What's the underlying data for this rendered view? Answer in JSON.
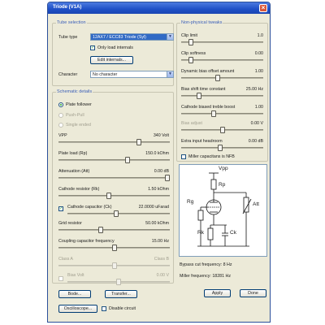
{
  "window": {
    "title": "Triode (V1A)"
  },
  "tube_selection": {
    "title": "Tube selection",
    "tube_type_label": "Tube type",
    "tube_type_value": "12AX7 / ECC83 Triode (Syl)",
    "only_load_internals_label": "Only load internals",
    "only_load_internals_checked": true,
    "edit_internals_button": "Edit internals...",
    "character_label": "Character",
    "character_value": "No character"
  },
  "schematic_details": {
    "title": "Schematic details",
    "plate_follower": "Plate follower",
    "push_pull": "Push-Pull",
    "single_ended": "Single ended",
    "selected_mode": "Plate follower",
    "vpp": {
      "label": "VPP",
      "value": "340 Volt",
      "level": 0.72
    },
    "plate_load": {
      "label": "Plate load (Rp)",
      "value": "150.0 kOhm",
      "level": 0.62
    },
    "attenuation": {
      "label": "Attenuation (Att)",
      "value": "0.00 dB",
      "level": 0.98
    },
    "cathode_resistor": {
      "label": "Cathode resistor (Rk)",
      "value": "1.50 kOhm",
      "level": 0.45
    },
    "cathode_capacitor": {
      "label": "Cathode capacitor (Ck)",
      "value": "22.0000 uFarad",
      "checked": true,
      "level": 0.48
    },
    "grid_resistor": {
      "label": "Grid resistor",
      "value": "50.00 kOhm",
      "level": 0.38
    },
    "coupling_capacitor": {
      "label": "Coupling capacitor frequency",
      "value": "15.00 Hz",
      "level": 0.5
    },
    "class_a": "Class A",
    "class_b": "Class B",
    "class_level": 0.5,
    "bias_volt": {
      "label": "Bias Volt",
      "value": "0.00 V",
      "level": 0.5
    }
  },
  "non_physical": {
    "title": "Non-physical tweaks",
    "clip_limit": {
      "label": "Clip limit",
      "value": "1.0",
      "level": 0.12
    },
    "clip_softness": {
      "label": "Clip softness",
      "value": "0.00",
      "level": 0.12
    },
    "dynamic_bias": {
      "label": "Dynamic bias offset amount",
      "value": "1.00",
      "level": 0.45
    },
    "bias_shift": {
      "label": "Bias shift time constant",
      "value": "25.00 Hz",
      "level": 0.22
    },
    "cathode_boost": {
      "label": "Cathode biased treble boost",
      "value": "1.00",
      "level": 0.4
    },
    "bias_adjust": {
      "label": "Bias adjust",
      "value": "0.00 V",
      "level": 0.5
    },
    "extra_headroom": {
      "label": "Extra input headroom",
      "value": "0.00 dB",
      "level": 0.48
    },
    "miller_label": "Miller capacitans is NFB",
    "miller_checked": false
  },
  "schematic_labels": {
    "vpp": "Vpp",
    "rp": "Rp",
    "rg": "Rg",
    "att": "Att",
    "rk": "Rk",
    "ck": "Ck"
  },
  "info": {
    "bypass": "Bypass cut frequency: 8 Hz",
    "miller": "Miller frequency: 18281 Hz"
  },
  "buttons": {
    "bode": "Bode...",
    "transfer": "Transfer...",
    "oscilloscope": "Oscilloscope...",
    "apply": "Apply",
    "done": "Done"
  },
  "disable_circuit_label": "Disable circuit",
  "disable_circuit_checked": false,
  "colors": {
    "titlebar": "#1e4fc6",
    "dialog_bg": "#ecead8",
    "group_title": "#3d60b8",
    "selection": "#316ac5"
  }
}
